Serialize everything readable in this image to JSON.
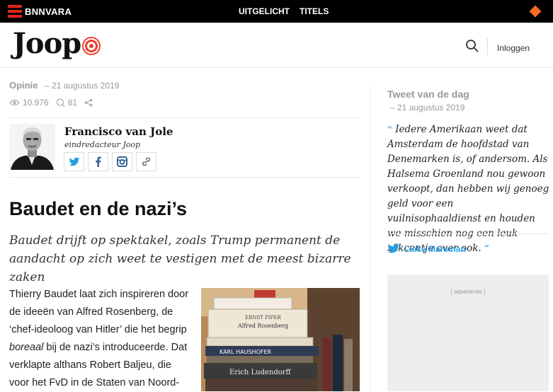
{
  "topbar": {
    "brand": "BNNVARA",
    "nav": [
      "UITGELICHT",
      "TITELS"
    ],
    "colors": {
      "bar": "#000000",
      "brand_red": "#e2231a",
      "diamond": "#f26d21"
    }
  },
  "header": {
    "logo_text": "Joop",
    "search_icon": "search-icon",
    "login_label": "Inloggen"
  },
  "article": {
    "category": "Opinie",
    "date": "– 21 augustus 2019",
    "views": "10.976",
    "comments": "81",
    "author": {
      "name": "Francisco van Jole",
      "role": "eindredacteur Joop",
      "social_icons": [
        "twitter-icon",
        "facebook-icon",
        "instagram-icon",
        "link-icon"
      ]
    },
    "title": "Baudet en de nazi’s",
    "lead": "Baudet drijft op spektakel, zoals Trump permanent de aandacht op zich weet te vestigen met de meest bizarre zaken",
    "body_part1": "Thierry Baudet laat zich inspireren door de ideeën van Alfred Rosenberg, de ‘chef-ideoloog van Hitler’ die het begrip ",
    "body_em": "boreaal",
    "body_part2": " bij de nazi’s introduceerde. Dat verklapte althans Robert Baljeu, die voor het FvD in de Staten van Noord-",
    "photo_book_titles": [
      "ERNST PIPER",
      "Alfred Rosenberg",
      "KARL HAUSHOFER",
      "Erich Ludendorff"
    ]
  },
  "sidebar": {
    "title": "Tweet van de dag",
    "date": "– 21 augustus 2019",
    "quote": "Iedere Amerikaan weet dat Amsterdam de hoofdstad van Denemarken is, of andersom. Als Halsema Groenland nou gewoon verkoopt, dan hebben wij genoeg geld voor een vuilnisophaaldienst en houden we misschien nog een leuk zakcentje over ook.",
    "quote_open": "“",
    "quote_close": "”",
    "tweeter": "Lieke Marsman",
    "ad_label": "[ advertentie ]",
    "accent": "#2aa3ef"
  }
}
